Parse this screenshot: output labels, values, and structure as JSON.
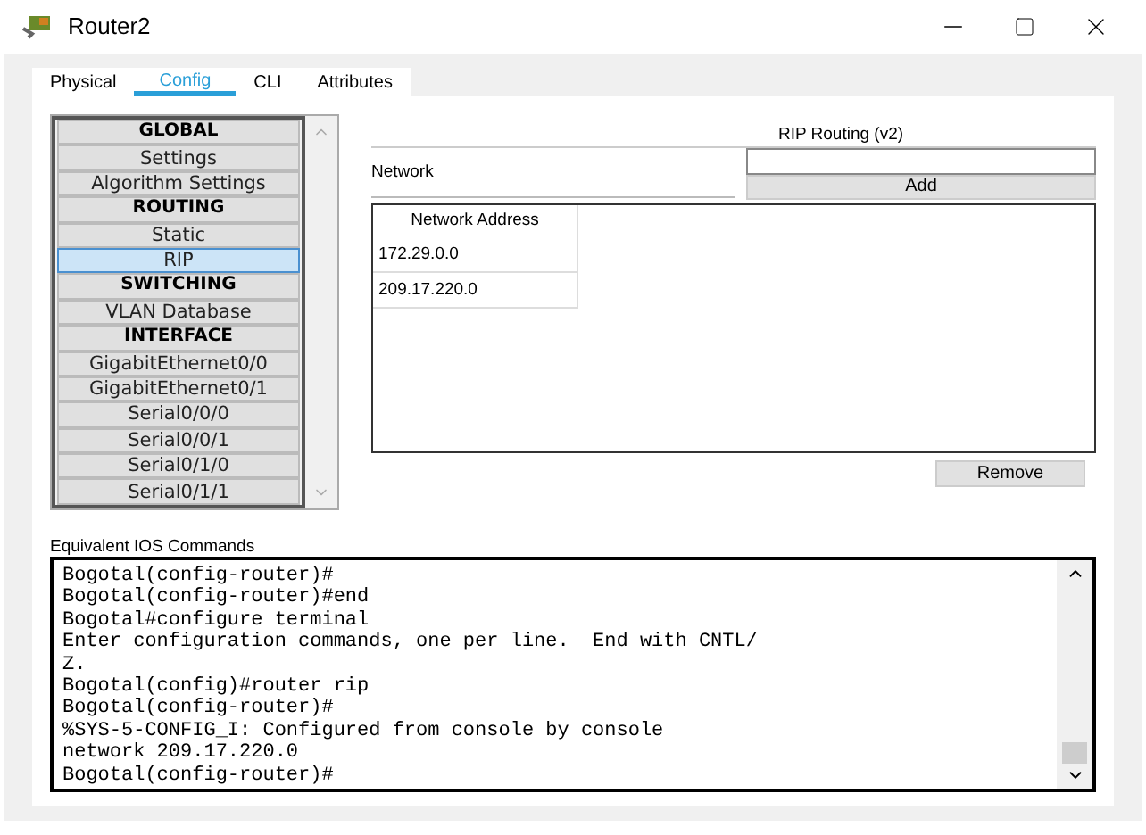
{
  "window": {
    "title": "Router2"
  },
  "tabs": [
    {
      "label": "Physical",
      "selected": false
    },
    {
      "label": "Config",
      "selected": true
    },
    {
      "label": "CLI",
      "selected": false
    },
    {
      "label": "Attributes",
      "selected": false
    }
  ],
  "sidebar": {
    "items": [
      {
        "label": "GLOBAL",
        "kind": "header",
        "selected": false
      },
      {
        "label": "Settings",
        "kind": "item",
        "selected": false
      },
      {
        "label": "Algorithm Settings",
        "kind": "item",
        "selected": false
      },
      {
        "label": "ROUTING",
        "kind": "header",
        "selected": false
      },
      {
        "label": "Static",
        "kind": "item",
        "selected": false
      },
      {
        "label": "RIP",
        "kind": "item",
        "selected": true
      },
      {
        "label": "SWITCHING",
        "kind": "header",
        "selected": false
      },
      {
        "label": "VLAN Database",
        "kind": "item",
        "selected": false
      },
      {
        "label": "INTERFACE",
        "kind": "header",
        "selected": false
      },
      {
        "label": "GigabitEthernet0/0",
        "kind": "item",
        "selected": false
      },
      {
        "label": "GigabitEthernet0/1",
        "kind": "item",
        "selected": false
      },
      {
        "label": "Serial0/0/0",
        "kind": "item",
        "selected": false
      },
      {
        "label": "Serial0/0/1",
        "kind": "item",
        "selected": false
      },
      {
        "label": "Serial0/1/0",
        "kind": "item",
        "selected": false
      },
      {
        "label": "Serial0/1/1",
        "kind": "item",
        "selected": false
      }
    ]
  },
  "rip": {
    "title": "RIP Routing (v2)",
    "network_label": "Network",
    "add_button": "Add",
    "table": {
      "columns": [
        "Network Address"
      ],
      "rows": [
        "172.29.0.0",
        "209.17.220.0"
      ]
    },
    "remove_button": "Remove"
  },
  "console": {
    "label": "Equivalent IOS Commands",
    "lines": [
      "Bogotal(config-router)#",
      "Bogotal(config-router)#end",
      "Bogotal#configure terminal",
      "Enter configuration commands, one per line.  End with CNTL/",
      "Z.",
      "Bogotal(config)#router rip",
      "Bogotal(config-router)#",
      "%SYS-5-CONFIG_I: Configured from console by console",
      "network 209.17.220.0",
      "Bogotal(config-router)#"
    ]
  }
}
